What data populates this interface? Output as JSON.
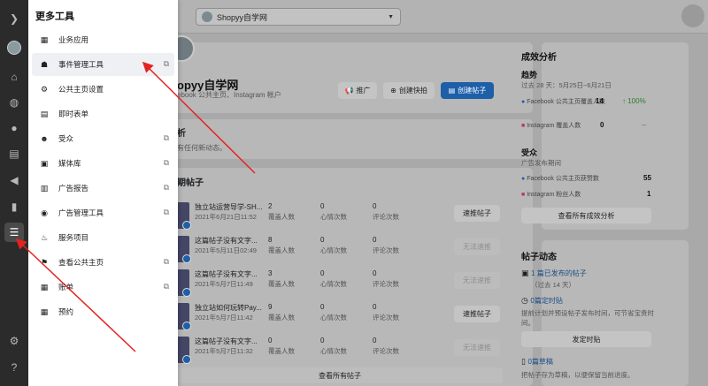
{
  "drawer": {
    "title": "更多工具",
    "items": [
      {
        "label": "业务应用",
        "icon": "grid-icon",
        "glyph": "▦",
        "external": false
      },
      {
        "label": "事件管理工具",
        "icon": "people-icon",
        "glyph": "☗",
        "external": true
      },
      {
        "label": "公共主页设置",
        "icon": "gear-icon",
        "glyph": "⚙",
        "external": false
      },
      {
        "label": "即时表单",
        "icon": "form-icon",
        "glyph": "▤",
        "external": false
      },
      {
        "label": "受众",
        "icon": "audience-icon",
        "glyph": "☻",
        "external": true
      },
      {
        "label": "媒体库",
        "icon": "image-icon",
        "glyph": "▣",
        "external": true
      },
      {
        "label": "广告报告",
        "icon": "report-icon",
        "glyph": "▥",
        "external": true
      },
      {
        "label": "广告管理工具",
        "icon": "ads-manager-icon",
        "glyph": "◉",
        "external": true
      },
      {
        "label": "服务项目",
        "icon": "bell-icon",
        "glyph": "♨",
        "external": false
      },
      {
        "label": "查看公共主页",
        "icon": "flag-icon",
        "glyph": "⚑",
        "external": true
      },
      {
        "label": "账单",
        "icon": "billing-icon",
        "glyph": "▦",
        "external": true
      },
      {
        "label": "预约",
        "icon": "calendar-icon",
        "glyph": "▦",
        "external": false
      }
    ]
  },
  "topbar": {
    "page_name": "Shopyy自学网"
  },
  "profile": {
    "name": "opyy自学网",
    "subtitle": "ebook 公共主页、Instagram 帐户",
    "btn_promote": "推广",
    "btn_quick": "创建快拍",
    "btn_create": "创建帖子"
  },
  "performance": {
    "title": "析",
    "subtitle": "有任何新动态。"
  },
  "posts": {
    "title": "期帖子",
    "metric_labels": [
      "覆盖人数",
      "心情次数",
      "评论次数"
    ],
    "rows": [
      {
        "text": "独立站运营导学-SH...",
        "date": "2021年6月21日11:52",
        "reach": "2",
        "reactions": "0",
        "comments": "0",
        "action": "速推帖子",
        "enabled": true
      },
      {
        "text": "这篇帖子没有文字...",
        "date": "2021年5月11日02:49",
        "reach": "8",
        "reactions": "0",
        "comments": "0",
        "action": "无法速推",
        "enabled": false
      },
      {
        "text": "这篇帖子没有文字...",
        "date": "2021年5月7日11:49",
        "reach": "3",
        "reactions": "0",
        "comments": "0",
        "action": "无法速推",
        "enabled": false
      },
      {
        "text": "独立站如何玩转Pay...",
        "date": "2021年5月7日11:42",
        "reach": "9",
        "reactions": "0",
        "comments": "0",
        "action": "速推帖子",
        "enabled": true
      },
      {
        "text": "这篇帖子没有文字...",
        "date": "2021年5月7日11:32",
        "reach": "0",
        "reactions": "0",
        "comments": "0",
        "action": "无法速推",
        "enabled": false
      }
    ],
    "view_all": "查看所有帖子"
  },
  "insights": {
    "title": "成效分析",
    "trend_head": "趋势",
    "trend_range": "过去 28 天：5月25日~6月21日",
    "fb_reach_label": "Facebook 公共主页覆盖人数",
    "fb_reach_value": "14",
    "fb_reach_change": "↑ 100%",
    "ig_reach_label": "Instagram 覆盖人数",
    "ig_reach_value": "0",
    "ig_reach_change": "--",
    "audience_head": "受众",
    "audience_sub": "广告发布期间",
    "fb_likes_label": "Facebook 公共主页获赞数",
    "fb_likes_value": "55",
    "ig_followers_label": "Instagram 粉丝人数",
    "ig_followers_value": "1",
    "view_all": "查看所有成效分析"
  },
  "dynamics": {
    "title": "帖子动态",
    "published_link": "1 篇已发布的帖子",
    "published_sub": "（过去 14 天）",
    "scheduled_link": "0篇定时贴",
    "scheduled_desc": "提前计划并预设帖子发布时间，可节省宝贵时间。",
    "schedule_btn": "发定时贴",
    "drafts_link": "0篇草稿",
    "drafts_desc": "把帖子存为草稿，以便保留当前进度。"
  },
  "rail": {
    "icons": [
      "expand-icon",
      "profile-avatar",
      "home-icon",
      "globe-icon",
      "messenger-icon",
      "pages-icon",
      "megaphone-icon",
      "insights-icon",
      "menu-icon",
      "settings-icon",
      "help-icon"
    ]
  }
}
